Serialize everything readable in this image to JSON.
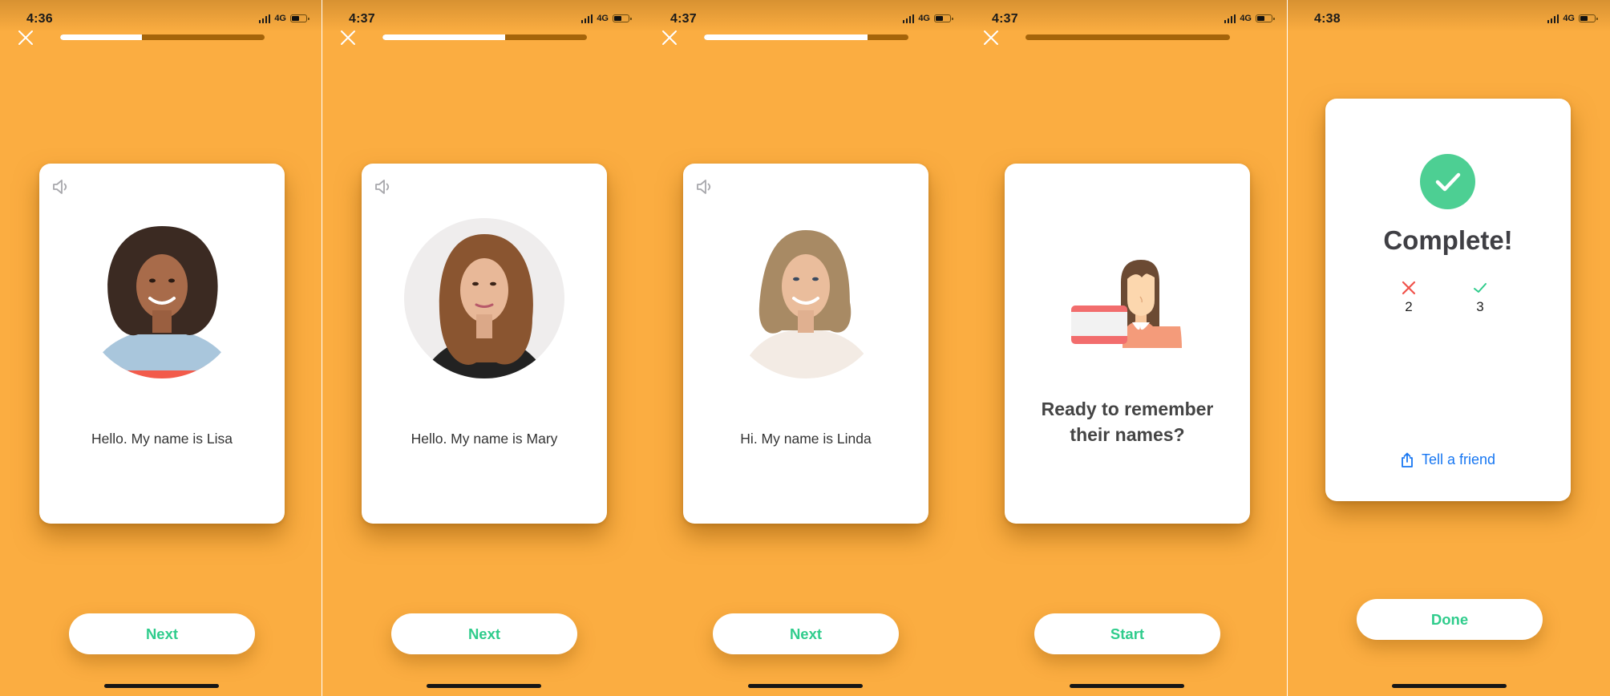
{
  "colors": {
    "background": "#fbad41",
    "progress_track": "#a5640a",
    "progress_fill": "#ffffff",
    "button_text": "#2fcc8c",
    "success": "#4dcf93",
    "error": "#f0524a",
    "link": "#1877f2"
  },
  "screens": [
    {
      "status": {
        "time": "4:36",
        "network": "4G"
      },
      "progress_percent": 40,
      "card": {
        "type": "person",
        "caption": "Hello. My name is Lisa",
        "speaker_icon": "speaker-icon"
      },
      "button_label": "Next"
    },
    {
      "status": {
        "time": "4:37",
        "network": "4G"
      },
      "progress_percent": 60,
      "card": {
        "type": "person",
        "caption": "Hello. My name is Mary",
        "speaker_icon": "speaker-icon"
      },
      "button_label": "Next"
    },
    {
      "status": {
        "time": "4:37",
        "network": "4G"
      },
      "progress_percent": 80,
      "card": {
        "type": "person",
        "caption": "Hi. My name is Linda",
        "speaker_icon": "speaker-icon"
      },
      "button_label": "Next"
    },
    {
      "status": {
        "time": "4:37",
        "network": "4G"
      },
      "progress_percent": 0,
      "card": {
        "type": "prompt",
        "title_line1": "Ready to remember",
        "title_line2": "their names?"
      },
      "button_label": "Start"
    },
    {
      "status": {
        "time": "4:38",
        "network": "4G"
      },
      "card": {
        "type": "result",
        "title": "Complete!",
        "wrong_count": "2",
        "correct_count": "3",
        "share_label": "Tell a friend"
      },
      "button_label": "Done"
    }
  ]
}
